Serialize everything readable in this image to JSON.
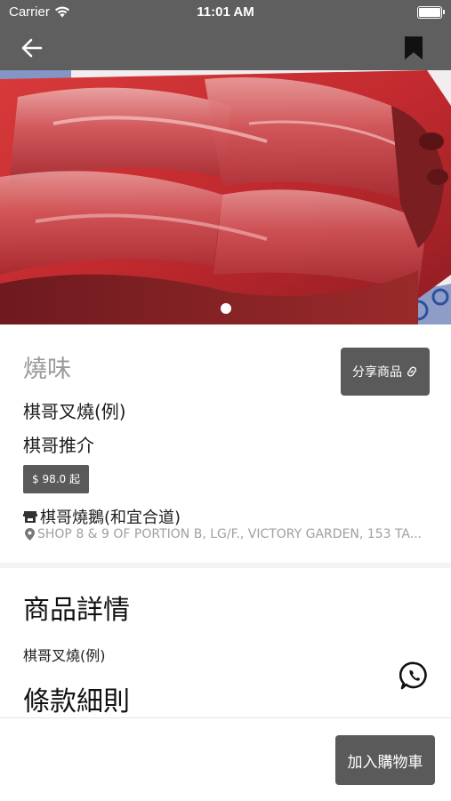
{
  "status_bar": {
    "carrier": "Carrier",
    "time": "11:01 AM"
  },
  "nav": {
    "back_icon": "arrow-left-icon",
    "bookmark_icon": "bookmark-icon"
  },
  "gallery": {
    "image_subject": "char siu roast pork",
    "page_dots": 1,
    "active_dot": 1
  },
  "product": {
    "category": "燒味",
    "share_label": "分享商品",
    "name": "棋哥叉燒(例)",
    "subtitle": "棋哥推介",
    "price": "$ 98.0 起",
    "shop_name": "棋哥燒鵝(和宜合道)",
    "address": "SHOP 8 & 9 OF PORTION B, LG/F., VICTORY GARDEN, 153 TA..."
  },
  "details": {
    "heading": "商品詳情",
    "description": "棋哥叉燒(例)",
    "terms_heading": "條款細則"
  },
  "bottom": {
    "add_to_cart": "加入購物車"
  },
  "colors": {
    "bar": "#5f5f5f",
    "button": "#5a5a5a",
    "muted": "#9a9a9a"
  }
}
